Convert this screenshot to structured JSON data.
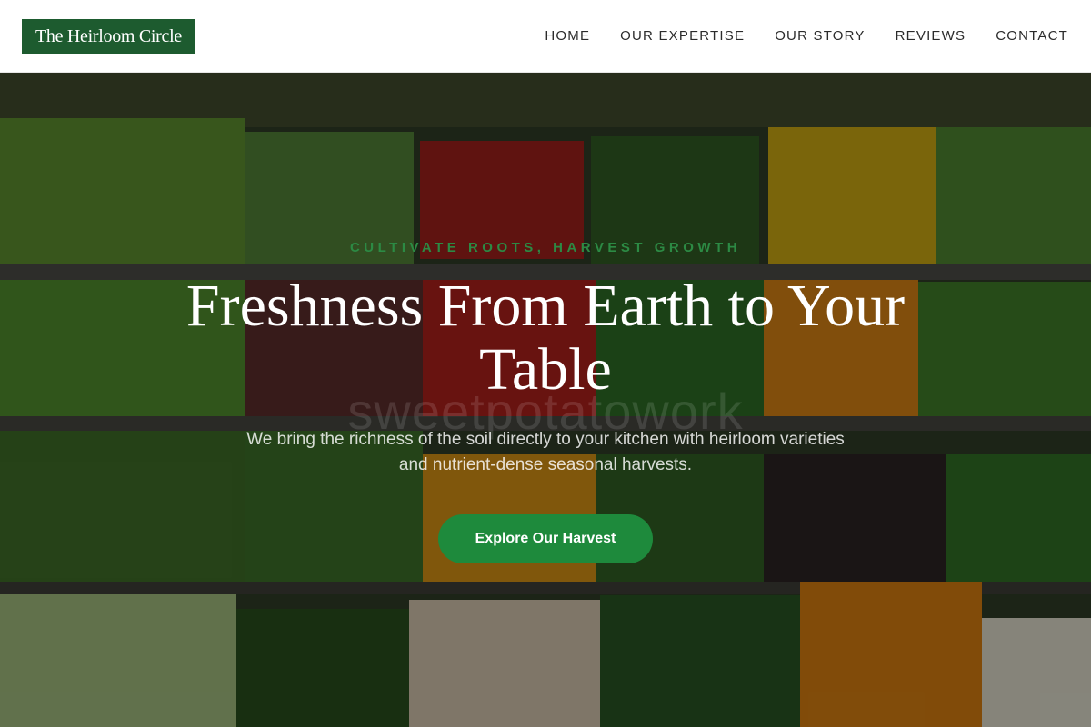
{
  "brand": {
    "name": "The Heirloom Circle",
    "color": "#1d5b2f"
  },
  "nav": {
    "items": [
      {
        "label": "HOME"
      },
      {
        "label": "OUR EXPERTISE"
      },
      {
        "label": "OUR STORY"
      },
      {
        "label": "REVIEWS"
      },
      {
        "label": "CONTACT"
      }
    ]
  },
  "hero": {
    "eyebrow": "CULTIVATE ROOTS, HARVEST GROWTH",
    "headline": "Freshness From Earth to Your Table",
    "watermark": "sweetpotatowork",
    "subtext": "We bring the richness of the soil directly to your kitchen with heirloom varieties and nutrient-dense seasonal harvests.",
    "cta_label": "Explore Our Harvest",
    "accent": "#1e8a3c",
    "image": "produce-market-shelves"
  }
}
